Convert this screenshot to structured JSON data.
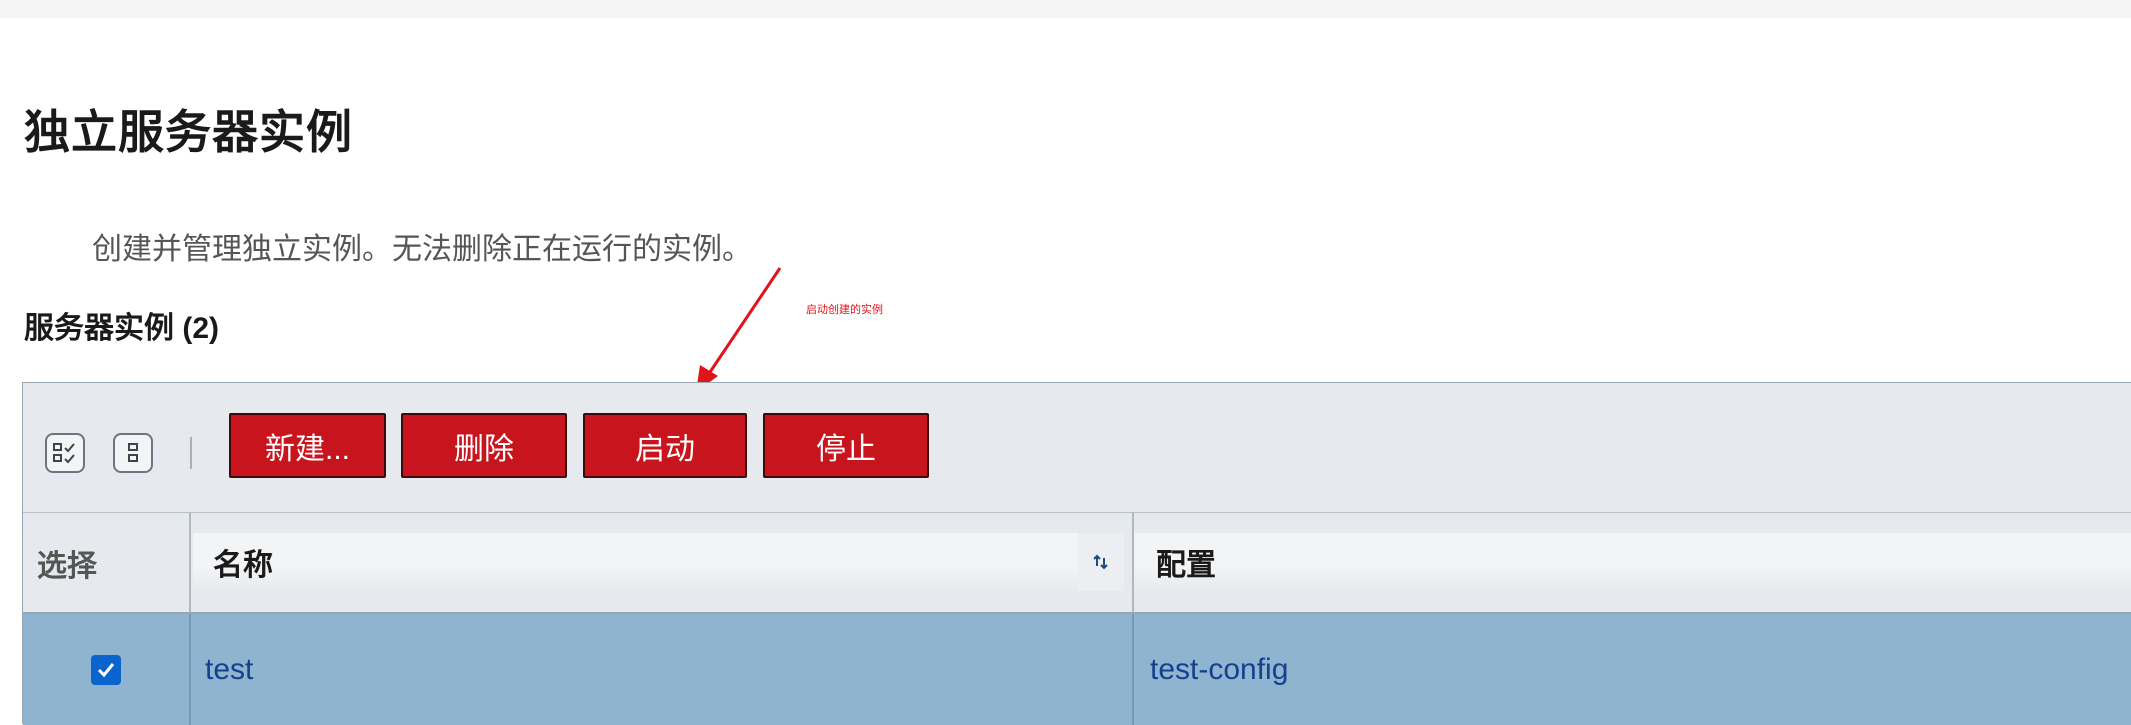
{
  "page": {
    "title": "独立服务器实例",
    "description": "创建并管理独立实例。无法删除正在运行的实例。"
  },
  "section": {
    "title": "服务器实例 (2)"
  },
  "annotation": {
    "text": "启动创建的实例",
    "color": "#e0151b"
  },
  "toolbar": {
    "select_all_icon": "select-all-icon",
    "deselect_all_icon": "deselect-all-icon",
    "new_label": "新建...",
    "delete_label": "删除",
    "start_label": "启动",
    "stop_label": "停止",
    "button_color": "#c8141c"
  },
  "table": {
    "columns": {
      "select": "选择",
      "name": "名称",
      "config": "配置"
    },
    "sort_icon": "sort-icon",
    "rows": [
      {
        "selected": true,
        "name": "test",
        "config": "test-config"
      }
    ],
    "selected_row_color": "#8fb4cf",
    "link_color": "#16408f"
  }
}
